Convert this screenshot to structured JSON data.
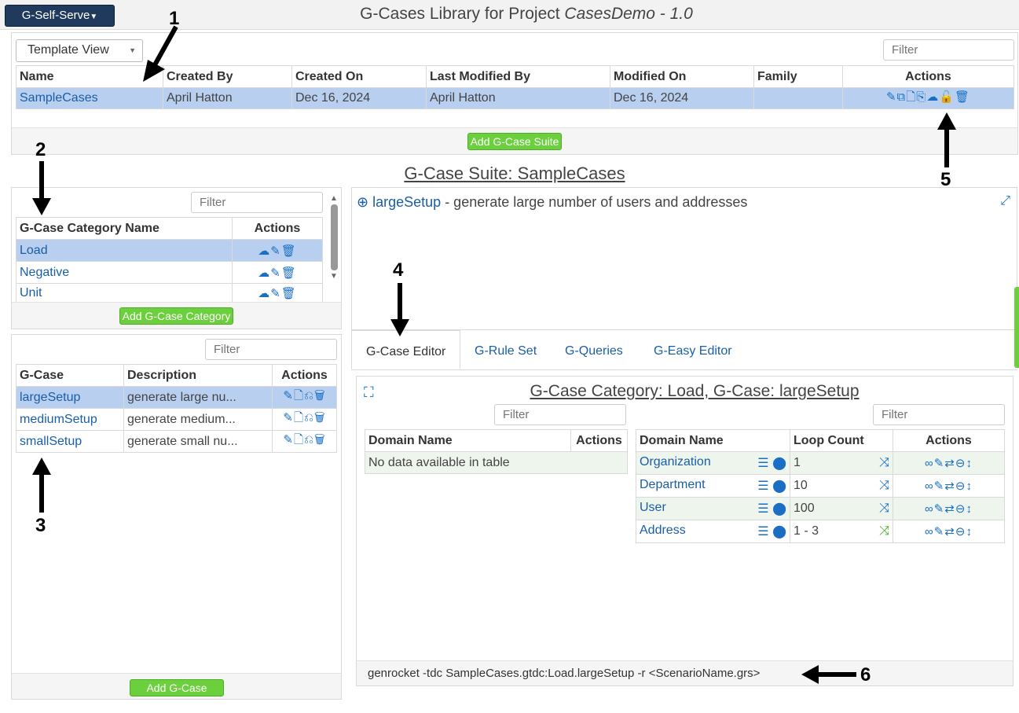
{
  "app_menu": "G-Self-Serve",
  "page_title": {
    "prefix": "G-Cases Library for Project ",
    "project": "CasesDemo - 1.0"
  },
  "suites": {
    "view_select": "Template View",
    "filter_placeholder": "Filter",
    "columns": [
      "Name",
      "Created By",
      "Created On",
      "Last Modified By",
      "Modified On",
      "Family",
      "Actions"
    ],
    "rows": [
      {
        "name": "SampleCases",
        "created_by": "April Hatton",
        "created_on": "Dec 16, 2024",
        "modified_by": "April Hatton",
        "modified_on": "Dec 16, 2024",
        "family": "",
        "icons": "✎⧉🗋⎘☁🔓🗑"
      }
    ],
    "add_button": "Add G-Case Suite"
  },
  "suite_heading": "G-Case Suite: SampleCases",
  "categories": {
    "filter_placeholder": "Filter",
    "columns": [
      "G-Case Category Name",
      "Actions"
    ],
    "rows": [
      {
        "name": "Load",
        "icons": "☁✎🗑"
      },
      {
        "name": "Negative",
        "icons": "☁✎🗑"
      },
      {
        "name": "Unit",
        "icons": "☁✎🗑"
      }
    ],
    "add_button": "Add G-Case Category"
  },
  "gcases": {
    "filter_placeholder": "Filter",
    "columns": [
      "G-Case",
      "Description",
      "Actions"
    ],
    "rows": [
      {
        "name": "largeSetup",
        "desc": "generate large nu...",
        "icons": "✎🗋⎌🗑"
      },
      {
        "name": "mediumSetup",
        "desc": "generate medium...",
        "icons": "✎🗋⎌🗑"
      },
      {
        "name": "smallSetup",
        "desc": "generate small nu...",
        "icons": "✎🗋⎌🗑"
      }
    ],
    "add_button": "Add G-Case"
  },
  "description": {
    "name": "largeSetup",
    "text": " - generate large number of users and addresses"
  },
  "tabs": [
    "G-Case Editor",
    "G-Rule Set",
    "G-Queries",
    "G-Easy Editor"
  ],
  "editor": {
    "heading": "G-Case Category: Load, G-Case: largeSetup",
    "left_filter": "Filter",
    "right_filter": "Filter",
    "left_columns": [
      "Domain Name",
      "Actions"
    ],
    "left_empty": "No data available in table",
    "right_columns": [
      "Domain Name",
      "Loop Count",
      "Actions"
    ],
    "domains": [
      {
        "name": "Organization",
        "loop": "1"
      },
      {
        "name": "Department",
        "loop": "10"
      },
      {
        "name": "User",
        "loop": "100"
      },
      {
        "name": "Address",
        "loop": "1 - 3"
      }
    ],
    "domain_icons": "∞✎⇄⊖↕",
    "command": "genrocket -tdc SampleCases.gtdc:Load.largeSetup -r <ScenarioName.grs>"
  },
  "callouts": [
    "1",
    "2",
    "3",
    "4",
    "5",
    "6"
  ],
  "colors": {
    "link": "#1a5fa6",
    "selected_row": "#b8cff0",
    "green_button": "#6ccf3e",
    "icon_blue": "#1a6fc4",
    "menu_button": "#1f3a5c"
  }
}
